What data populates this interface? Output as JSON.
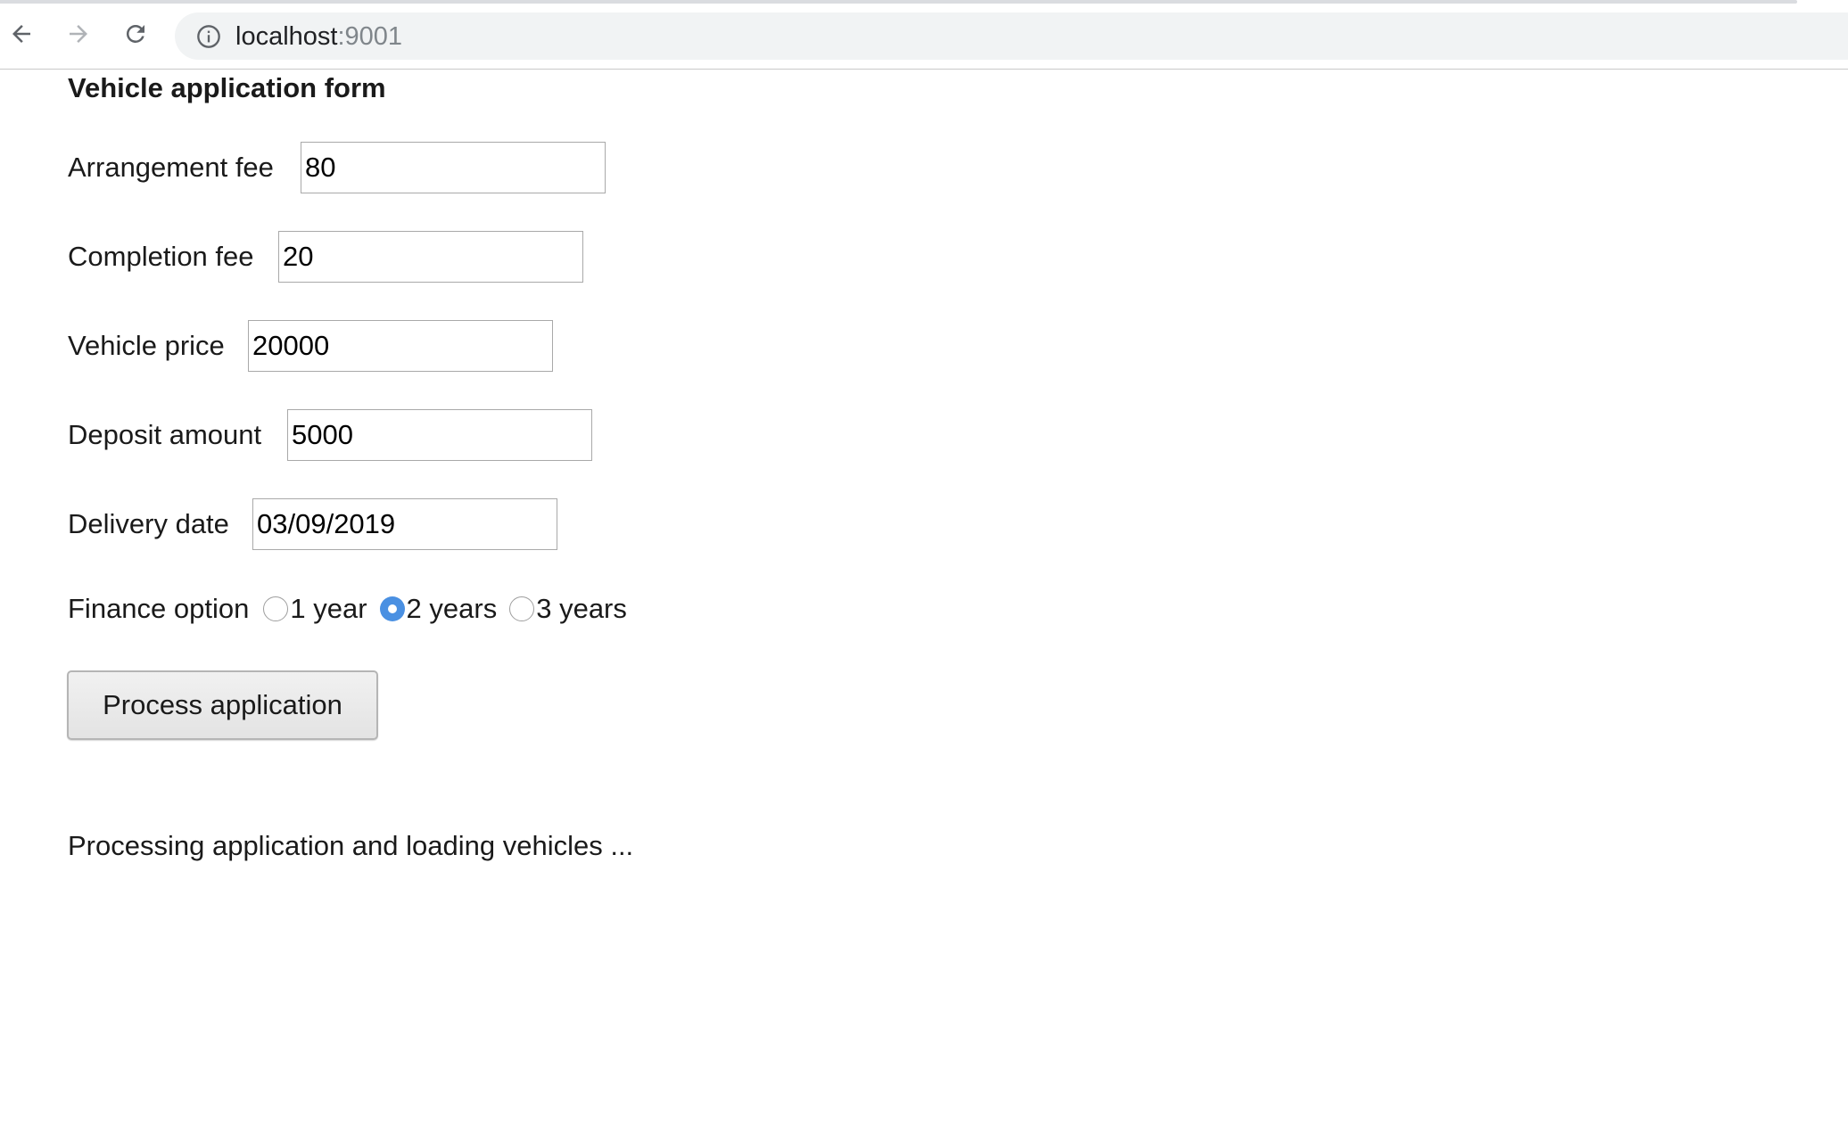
{
  "browser": {
    "url_host": "localhost",
    "url_port": ":9001"
  },
  "form": {
    "title": "Vehicle application form",
    "fields": {
      "arrangement_fee": {
        "label": "Arrangement fee",
        "value": "80"
      },
      "completion_fee": {
        "label": "Completion fee",
        "value": "20"
      },
      "vehicle_price": {
        "label": "Vehicle price",
        "value": "20000"
      },
      "deposit_amount": {
        "label": "Deposit amount",
        "value": "5000"
      },
      "delivery_date": {
        "label": "Delivery date",
        "value": "03/09/2019"
      }
    },
    "finance_option": {
      "label": "Finance option",
      "options": [
        "1 year",
        "2 years",
        "3 years"
      ],
      "selected": "2 years"
    },
    "submit_label": "Process application"
  },
  "status": {
    "message": "Processing application and loading vehicles ..."
  },
  "colors": {
    "radio_selected": "#4a90e2",
    "omnibox_bg": "#f1f3f4"
  }
}
